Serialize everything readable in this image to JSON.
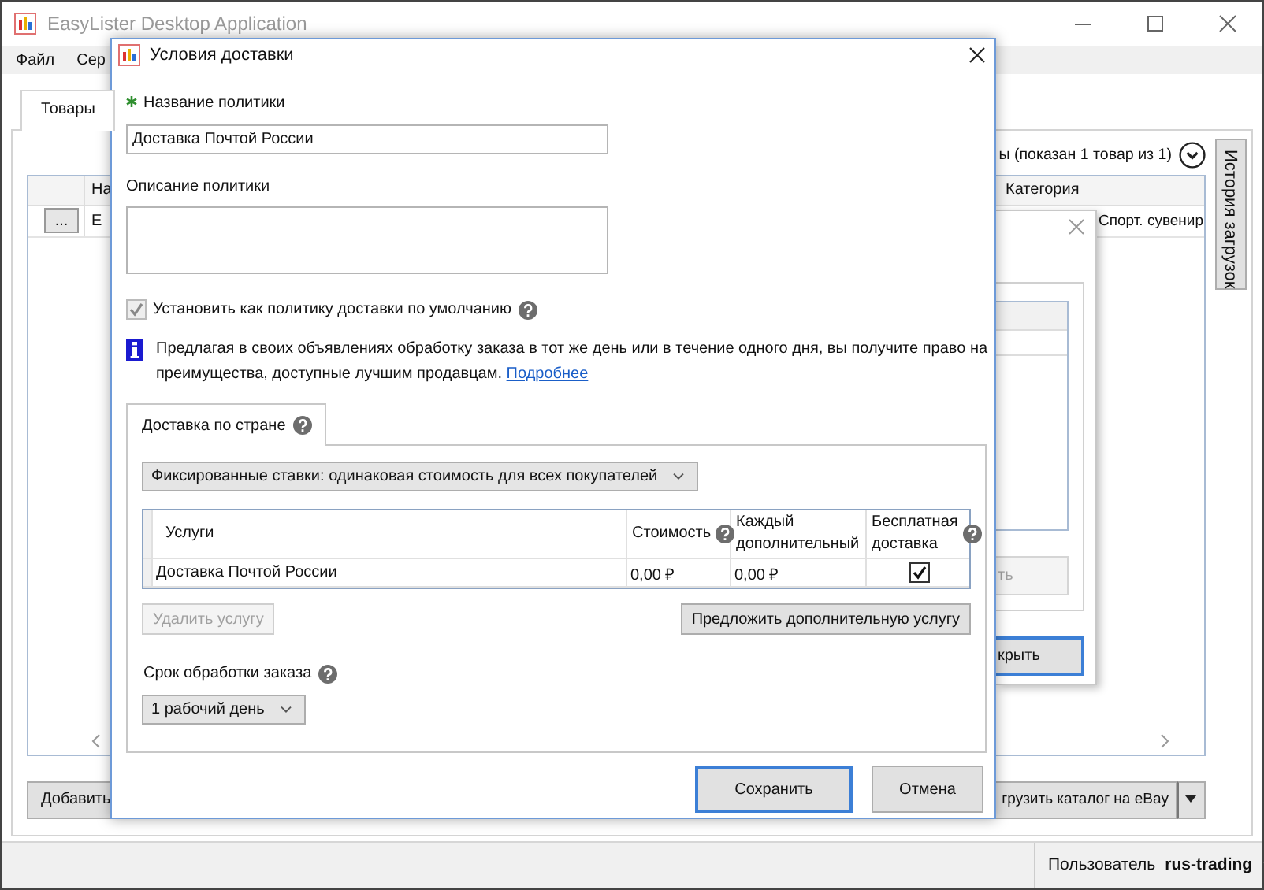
{
  "main_window": {
    "title": "EasyLister Desktop Application",
    "menu": [
      {
        "label": "Файл"
      },
      {
        "label": "Сер"
      }
    ],
    "tabs": [
      {
        "label": "Товары",
        "selected": true
      }
    ],
    "summary": "ы (показан 1 товар из 1)",
    "side_tab": {
      "label": "История загрузок"
    },
    "grid": {
      "columns": [
        "На",
        "Категория"
      ],
      "rows": [
        {
          "button": "...",
          "cells": [
            "Е",
            "Спорт. сувенир"
          ]
        }
      ]
    },
    "add_button": {
      "label": "Добавить"
    },
    "upload_button": {
      "label": "грузить каталог на eBay"
    },
    "status_bar": {
      "label": "Пользователь",
      "user": "rus-trading"
    }
  },
  "background_dialog": {
    "buttons": [
      {
        "label": "ть",
        "disabled": true,
        "default": false
      },
      {
        "label": "крыть",
        "disabled": false,
        "default": true
      }
    ]
  },
  "dialog": {
    "title": "Условия доставки",
    "name_field": {
      "label": "Название политики",
      "required": true,
      "value": "Доставка Почтой России"
    },
    "description_field": {
      "label": "Описание политики",
      "required": false
    },
    "default_policy": {
      "label": "Установить как политику доставки по умолчанию",
      "checked": true,
      "disabled": true,
      "help": true
    },
    "info": {
      "text": "Предлагая в своих объявлениях обработку заказа в тот же день или в течение одного дня, вы получите право на преимущества, доступные лучшим продавцам.",
      "link": "Подробнее"
    },
    "tabs": [
      {
        "label": "Доставка по стране",
        "selected": true,
        "help": true
      }
    ],
    "rate_type": {
      "value": "Фиксированные ставки: одинаковая стоимость для всех покупателей"
    },
    "services": {
      "columns": [
        {
          "label": "Услуги",
          "help": false
        },
        {
          "label": "Стоимость",
          "help": true
        },
        {
          "label": "Каждый дополнительный",
          "help": false
        },
        {
          "label": "Бесплатная доставка",
          "help": true
        }
      ],
      "rows": [
        {
          "service": "Доставка Почтой России",
          "cost": "0,00 ₽",
          "each_additional": "0,00 ₽",
          "free_shipping": true
        }
      ]
    },
    "remove_button": {
      "label": "Удалить услугу",
      "disabled": true
    },
    "offer_button": {
      "label": "Предложить дополнительную услугу",
      "disabled": false
    },
    "handling_time": {
      "label": "Срок обработки заказа",
      "help": true,
      "value": "1 рабочий день"
    },
    "buttons": [
      {
        "label": "Сохранить",
        "default": true
      },
      {
        "label": "Отмена",
        "default": false
      }
    ]
  }
}
